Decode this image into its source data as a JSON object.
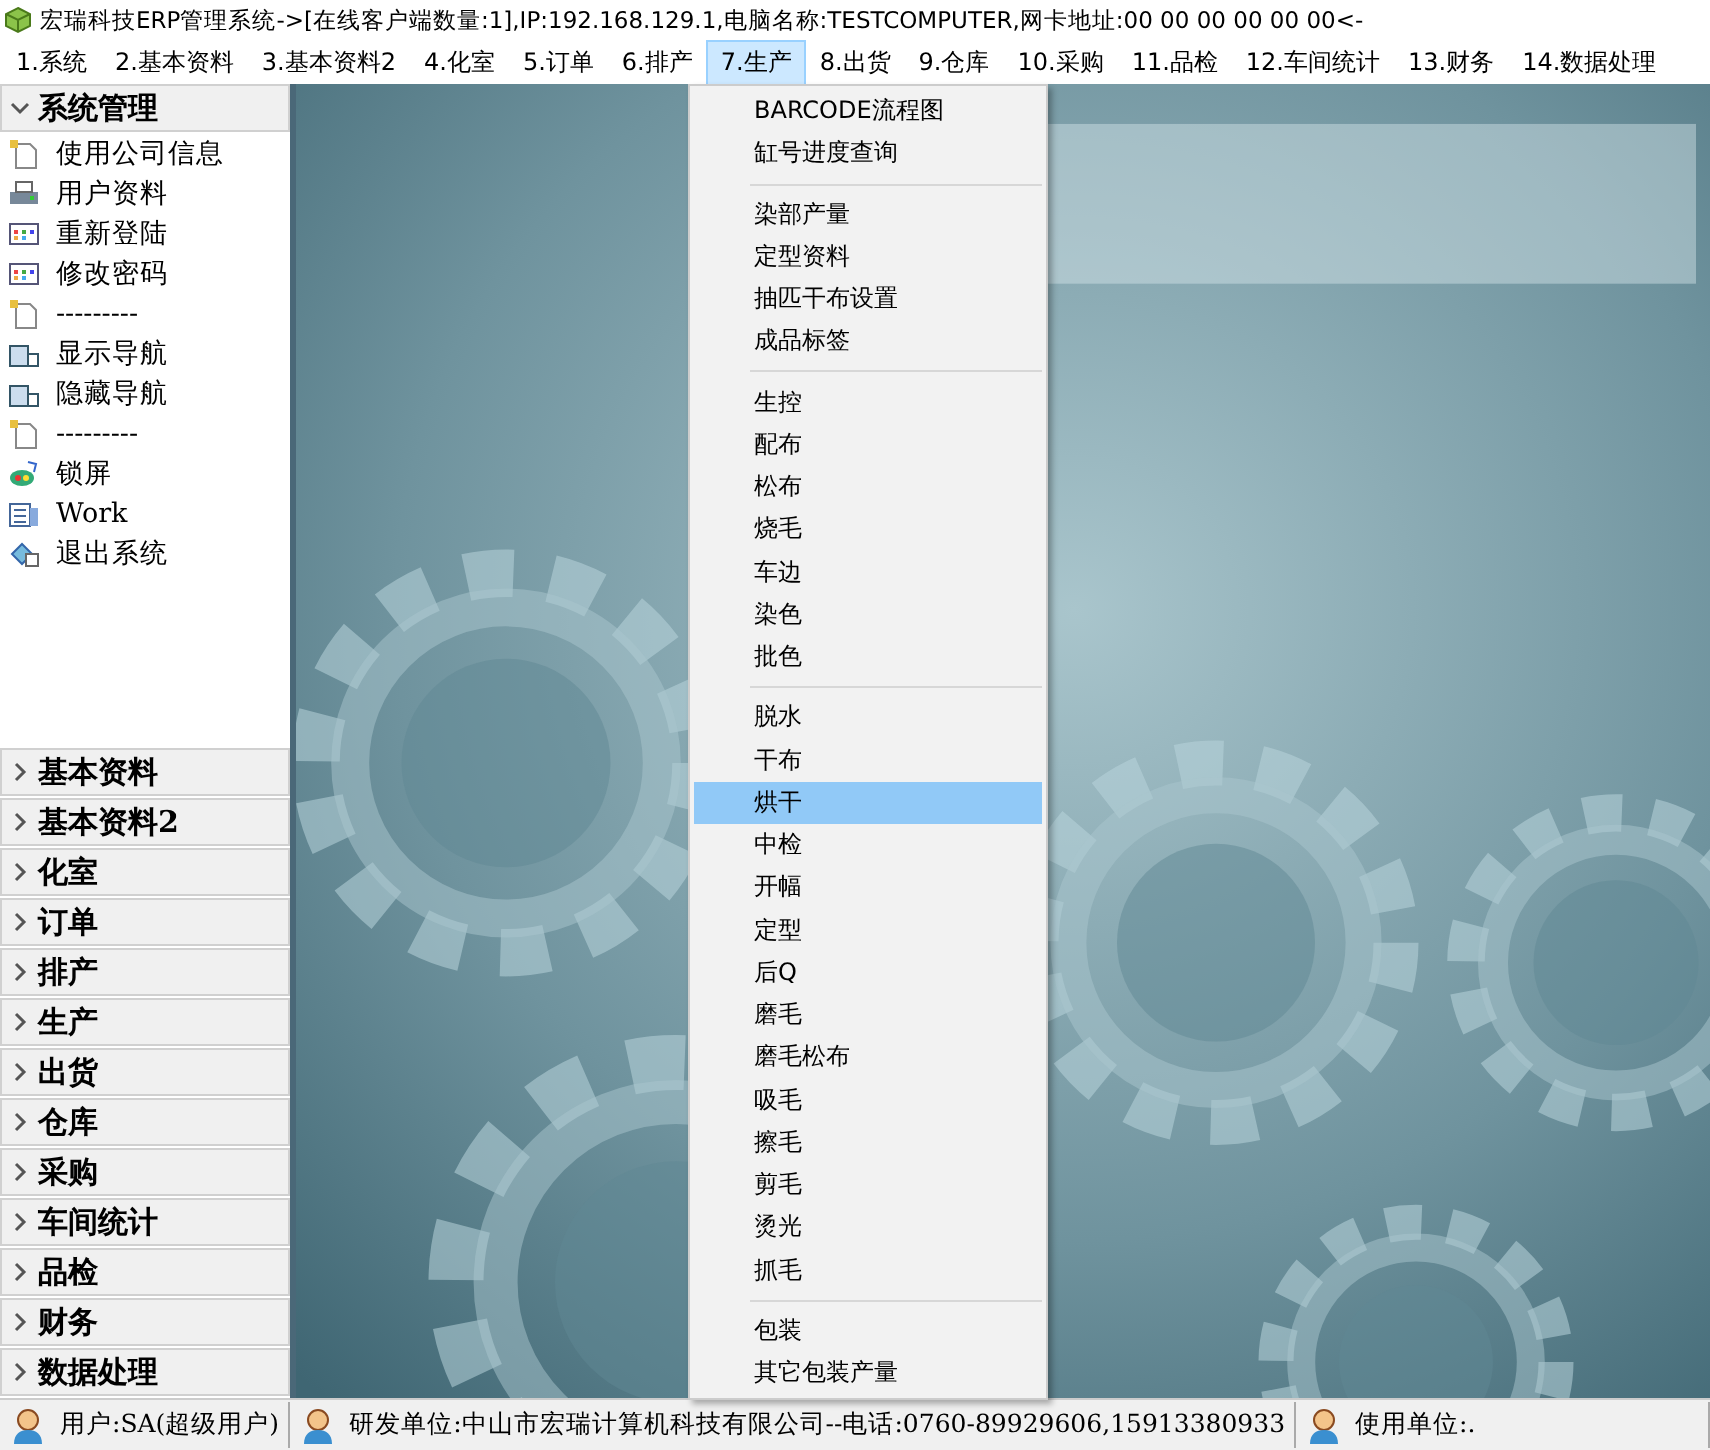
{
  "window": {
    "title": "宏瑞科技ERP管理系统->[在线客户端数量:1],IP:192.168.129.1,电脑名称:TESTCOMPUTER,网卡地址:00 00 00 00 00 00<-"
  },
  "menu_bar": [
    {
      "label": "1.系统",
      "selected": false
    },
    {
      "label": "2.基本资料",
      "selected": false
    },
    {
      "label": "3.基本资料2",
      "selected": false
    },
    {
      "label": "4.化室",
      "selected": false
    },
    {
      "label": "5.订单",
      "selected": false
    },
    {
      "label": "6.排产",
      "selected": false
    },
    {
      "label": "7.生产",
      "selected": true
    },
    {
      "label": "8.出货",
      "selected": false
    },
    {
      "label": "9.仓库",
      "selected": false
    },
    {
      "label": "10.采购",
      "selected": false
    },
    {
      "label": "11.品检",
      "selected": false
    },
    {
      "label": "12.车间统计",
      "selected": false
    },
    {
      "label": "13.财务",
      "selected": false
    },
    {
      "label": "14.数据处理",
      "selected": false
    }
  ],
  "sidebar": {
    "groups": [
      {
        "label": "系统管理",
        "expanded": true,
        "items": [
          {
            "label": "使用公司信息"
          },
          {
            "label": "用户资料"
          },
          {
            "label": "重新登陆"
          },
          {
            "label": "修改密码"
          },
          {
            "label": "---------"
          },
          {
            "label": "显示导航"
          },
          {
            "label": "隐藏导航"
          },
          {
            "label": "---------"
          },
          {
            "label": "锁屏"
          },
          {
            "label": "Work"
          },
          {
            "label": "退出系统"
          }
        ]
      },
      {
        "label": "基本资料",
        "expanded": false
      },
      {
        "label": "基本资料2",
        "expanded": false
      },
      {
        "label": "化室",
        "expanded": false
      },
      {
        "label": "订单",
        "expanded": false
      },
      {
        "label": "排产",
        "expanded": false
      },
      {
        "label": "生产",
        "expanded": false
      },
      {
        "label": "出货",
        "expanded": false
      },
      {
        "label": "仓库",
        "expanded": false
      },
      {
        "label": "采购",
        "expanded": false
      },
      {
        "label": "车间统计",
        "expanded": false
      },
      {
        "label": "品检",
        "expanded": false
      },
      {
        "label": "财务",
        "expanded": false
      },
      {
        "label": "数据处理",
        "expanded": false
      }
    ]
  },
  "dropdown": [
    {
      "kind": "item",
      "label": "BARCODE流程图",
      "selected": false
    },
    {
      "kind": "item",
      "label": "缸号进度查询",
      "selected": false
    },
    {
      "kind": "separator"
    },
    {
      "kind": "item",
      "label": "染部产量",
      "selected": false
    },
    {
      "kind": "item",
      "label": "定型资料",
      "selected": false
    },
    {
      "kind": "item",
      "label": "抽匹干布设置",
      "selected": false
    },
    {
      "kind": "item",
      "label": "成品标签",
      "selected": false
    },
    {
      "kind": "separator"
    },
    {
      "kind": "item",
      "label": "生控",
      "selected": false
    },
    {
      "kind": "item",
      "label": "配布",
      "selected": false
    },
    {
      "kind": "item",
      "label": "松布",
      "selected": false
    },
    {
      "kind": "item",
      "label": "烧毛",
      "selected": false
    },
    {
      "kind": "item",
      "label": "车边",
      "selected": false
    },
    {
      "kind": "item",
      "label": "染色",
      "selected": false
    },
    {
      "kind": "item",
      "label": "批色",
      "selected": false
    },
    {
      "kind": "separator"
    },
    {
      "kind": "item",
      "label": "脱水",
      "selected": false
    },
    {
      "kind": "item",
      "label": "干布",
      "selected": false
    },
    {
      "kind": "item",
      "label": "烘干",
      "selected": true
    },
    {
      "kind": "item",
      "label": "中检",
      "selected": false
    },
    {
      "kind": "item",
      "label": "开幅",
      "selected": false
    },
    {
      "kind": "item",
      "label": "定型",
      "selected": false
    },
    {
      "kind": "item",
      "label": "后Q",
      "selected": false
    },
    {
      "kind": "item",
      "label": "磨毛",
      "selected": false
    },
    {
      "kind": "item",
      "label": "磨毛松布",
      "selected": false
    },
    {
      "kind": "item",
      "label": "吸毛",
      "selected": false
    },
    {
      "kind": "item",
      "label": "擦毛",
      "selected": false
    },
    {
      "kind": "item",
      "label": "剪毛",
      "selected": false
    },
    {
      "kind": "item",
      "label": "烫光",
      "selected": false
    },
    {
      "kind": "item",
      "label": "抓毛",
      "selected": false
    },
    {
      "kind": "separator"
    },
    {
      "kind": "item",
      "label": "包装",
      "selected": false
    },
    {
      "kind": "item",
      "label": "其它包装产量",
      "selected": false
    }
  ],
  "status_bar": [
    "用户:SA(超级用户)",
    "研发单位:中山市宏瑞计算机科技有限公司--电话:0760-89929606,15913380933",
    "使用单位:."
  ]
}
